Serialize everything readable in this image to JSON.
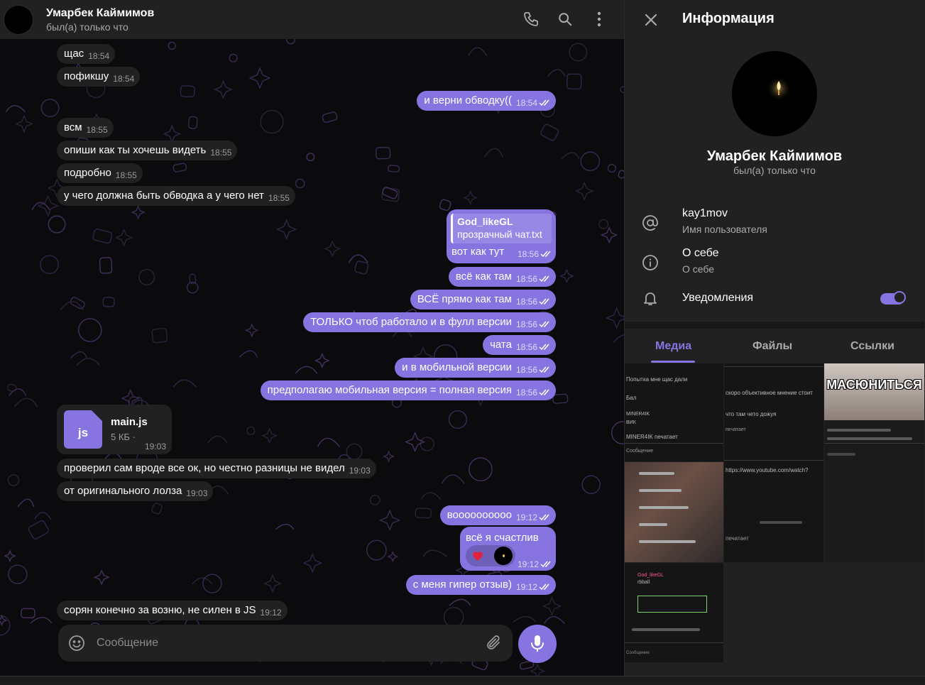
{
  "chat": {
    "header": {
      "name": "Умарбек Каймимов",
      "status": "был(а) только что"
    },
    "messages": [
      {
        "dir": "in",
        "text": "щас",
        "time": "18:54"
      },
      {
        "dir": "in",
        "text": "пофикшу",
        "time": "18:54"
      },
      {
        "dir": "out",
        "text": "и верни обводку((",
        "time": "18:54"
      },
      {
        "dir": "in",
        "text": "всм",
        "time": "18:55"
      },
      {
        "dir": "in",
        "text": "опиши как ты хочешь видеть",
        "time": "18:55"
      },
      {
        "dir": "in",
        "text": "подробно",
        "time": "18:55"
      },
      {
        "dir": "in",
        "text": "у чего должна быть обводка а у чего нет",
        "time": "18:55"
      },
      {
        "dir": "out",
        "text": "вот как тут",
        "time": "18:56",
        "reply": {
          "name": "God_likeGL",
          "text": "прозрачный чат.txt"
        }
      },
      {
        "dir": "out",
        "text": "всё как там",
        "time": "18:56"
      },
      {
        "dir": "out",
        "text": "ВСЁ прямо как там",
        "time": "18:56"
      },
      {
        "dir": "out",
        "text": "ТОЛЬКО чтоб работало и в фулл версии",
        "time": "18:56"
      },
      {
        "dir": "out",
        "text": "чата",
        "time": "18:56"
      },
      {
        "dir": "out",
        "text": "и в мобильной версии",
        "time": "18:56"
      },
      {
        "dir": "out",
        "text": "предполагаю мобильная версия = полная версия",
        "time": "18:56"
      },
      {
        "dir": "in",
        "type": "file",
        "file_name": "main.js",
        "file_ext": "js",
        "file_size": "5 КБ ·",
        "time": "19:03"
      },
      {
        "dir": "in",
        "text": "проверил сам вроде все ок, но честно разницы не видел",
        "time": "19:03"
      },
      {
        "dir": "in",
        "text": "от оригинального лолза",
        "time": "19:03"
      },
      {
        "dir": "out",
        "text": "воооооооооо",
        "time": "19:12"
      },
      {
        "dir": "out",
        "text": "всё я счастлив",
        "time": "19:12",
        "reactions": [
          "heart",
          "user-avatar"
        ]
      },
      {
        "dir": "out",
        "text": "с меня гипер отзыв)",
        "time": "19:12"
      },
      {
        "dir": "in",
        "text": "сорян конечно за возню, не силен в JS",
        "time": "19:12"
      }
    ],
    "composer": {
      "placeholder": "Сообщение"
    }
  },
  "info": {
    "title": "Информация",
    "name": "Умарбек Каймимов",
    "status": "был(а) только что",
    "username": "kay1mov",
    "username_label": "Имя пользователя",
    "bio": "О себе",
    "bio_label": "О себе",
    "notifications_label": "Уведомления",
    "notifications_on": true,
    "tabs": [
      "Медиа",
      "Файлы",
      "Ссылки"
    ],
    "active_tab": "Медиа",
    "media": [
      {
        "kind": "screenshot",
        "lines": [
          "Попытка мне щас дали",
          "Бал",
          "MINER4IK",
          "ВИК",
          "MINER4IK печатает",
          "Сообщение"
        ]
      },
      {
        "kind": "screenshot",
        "lines": [
          "скоро объективное мнение стоит",
          "что там чето дожуя",
          "печатает",
          "https://www.youtube.com/watch?",
          "печатает"
        ]
      },
      {
        "kind": "meme",
        "caption": "МАСЮНИТЬСЯ"
      },
      {
        "kind": "screenshot-photo",
        "lines": []
      },
      {
        "kind": "screenshot",
        "lines": [
          "God_likeGL",
          "rbball",
          "Сообщение"
        ]
      }
    ]
  },
  "colors": {
    "accent": "#8774e1",
    "panel": "#212121",
    "chat_bg": "#0b0b0d",
    "muted_text": "#aaaaaa"
  }
}
